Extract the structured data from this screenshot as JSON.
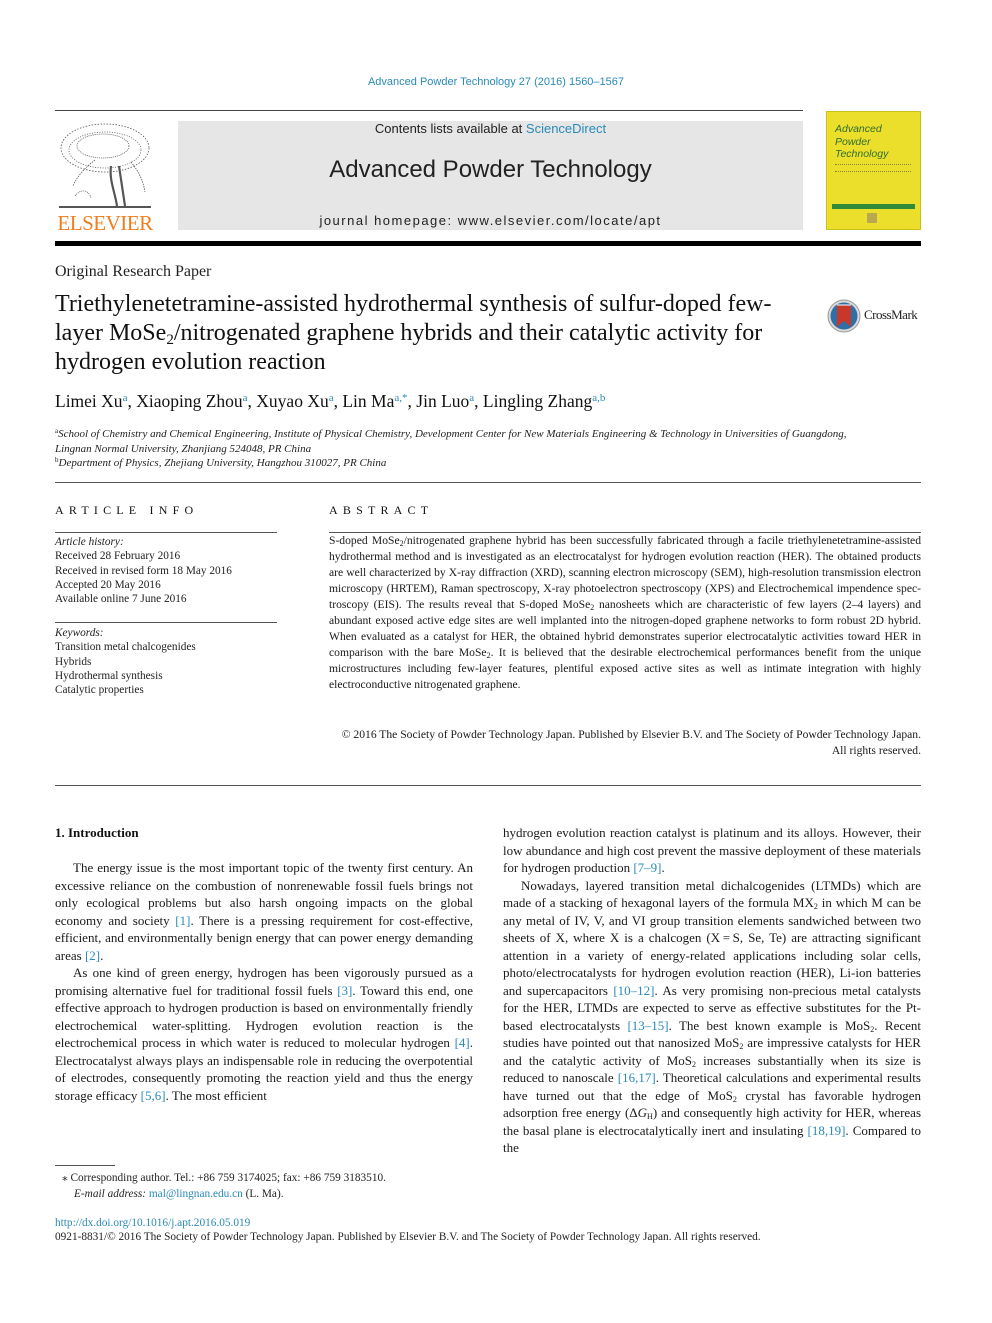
{
  "running_head": "Advanced Powder Technology 27 (2016) 1560–1567",
  "masthead": {
    "publisher_logo_text": "ELSEVIER",
    "contents_prefix": "Contents lists available at ",
    "contents_link": "ScienceDirect",
    "journal_title": "Advanced Powder Technology",
    "homepage_prefix": "journal homepage: ",
    "homepage_url": "www.elsevier.com/locate/apt",
    "cover_title_lines": [
      "Advanced",
      "Powder",
      "Technology"
    ]
  },
  "article": {
    "type": "Original Research Paper",
    "title_part1": "Triethylenetetramine-assisted hydrothermal synthesis of sulfur-doped few-layer MoSe",
    "title_sub": "2",
    "title_part2": "/nitrogenated graphene hybrids and their catalytic activity for hydrogen evolution reaction",
    "crossmark_label": "CrossMark",
    "authors": [
      {
        "name": "Limei Xu",
        "aff": "a"
      },
      {
        "name": "Xiaoping Zhou",
        "aff": "a"
      },
      {
        "name": "Xuyao Xu",
        "aff": "a"
      },
      {
        "name": "Lin Ma",
        "aff": "a,*"
      },
      {
        "name": "Jin Luo",
        "aff": "a"
      },
      {
        "name": "Lingling Zhang",
        "aff": "a,b"
      }
    ],
    "affiliations": [
      {
        "mark": "a",
        "text": "School of Chemistry and Chemical Engineering, Institute of Physical Chemistry, Development Center for New Materials Engineering & Technology in Universities of Guangdong, Lingnan Normal University, Zhanjiang 524048, PR China"
      },
      {
        "mark": "b",
        "text": "Department of Physics, Zhejiang University, Hangzhou 310027, PR China"
      }
    ]
  },
  "article_info": {
    "heading": "ARTICLE INFO",
    "history_label": "Article history:",
    "history": [
      "Received 28 February 2016",
      "Received in revised form 18 May 2016",
      "Accepted 20 May 2016",
      "Available online 7 June 2016"
    ],
    "keywords_label": "Keywords:",
    "keywords": [
      "Transition metal chalcogenides",
      "Hybrids",
      "Hydrothermal synthesis",
      "Catalytic properties"
    ]
  },
  "abstract": {
    "heading": "ABSTRACT",
    "seg1": "S-doped MoSe",
    "seg2": "/nitrogenated graphene hybrid has been successfully fabricated through a facile triethylenetetramine-assisted hydrothermal method and is investigated as an electrocatalyst for hydro­gen evolution reaction (HER). The obtained products are well characterized by X-ray diffraction (XRD), scanning electron microscopy (SEM), high-resolution transmission electron microscopy (HRTEM), Raman spectroscopy, X-ray photoelectron spectroscopy (XPS) and Electrochemical impendence spec­troscopy (EIS). The results reveal that S-doped MoSe",
    "seg3": " nanosheets which are characteristic of few layers (2–4 layers) and abundant exposed active edge sites are well implanted into the nitrogen-doped gra­phene networks to form robust 2D hybrid. When evaluated as a catalyst for HER, the obtained hybrid demonstrates superior electrocatalytic activities toward HER in comparison with the bare MoSe",
    "seg4": ". It is believed that the desirable electrochemical performances benefit from the unique microstructures including few-layer features, plentiful exposed active sites as well as intimate integration with highly electroconductive nitrogenated graphene.",
    "sub": "2",
    "copyright": "© 2016 The Society of Powder Technology Japan. Published by Elsevier B.V. and The Society of Powder Technology Japan. All rights reserved."
  },
  "introduction": {
    "heading": "1. Introduction",
    "p1_a": "The energy issue is the most important topic of the twenty first century. An excessive reliance on the combustion of nonrenewable fossil fuels brings not only ecological problems but also harsh ongoing impacts on the global economy and society ",
    "p1_ref1": "[1]",
    "p1_b": ". There is a pressing requirement for cost-effective, efficient, and environ­mentally benign energy that can power energy demanding areas ",
    "p1_ref2": "[2]",
    "p1_c": ".",
    "p2_a": "As one kind of green energy, hydrogen has been vigorously pur­sued as a promising alternative fuel for traditional fossil fuels ",
    "p2_ref1": "[3]",
    "p2_b": ". Toward this end, one effective approach to hydrogen production is based on environmentally friendly electrochemical water-splitting. Hydrogen evolution reaction is the electrochemical process in which water is reduced to molecular hydrogen ",
    "p2_ref2": "[4]",
    "p2_c": ". Electrocatalyst always plays an indispensable role in reducing the overpotential of electrodes, consequently promoting the reaction yield and thus the energy storage efficacy ",
    "p2_ref3": "[5,6]",
    "p2_d": ". The most efficient hydrogen evolution reaction catalyst is platinum and its alloys. However, their low abundance and high cost prevent the massive deployment of these materials for hydrogen production ",
    "p2_ref4": "[7–9]",
    "p2_e": ".",
    "p3_a": "Nowadays, layered transition metal dichalcogenides (LTMDs) which are made of a stacking of hexagonal layers of the formula MX",
    "p3_b": " in which M can be any metal of IV, V, and VI group transition elements sandwiched between two sheets of X, where X is a chalcogen (X = S, Se, Te) are attracting significant attention in a variety of energy-related applications including solar cells, photo/electrocatalysts for hydrogen evolution reaction (HER), Li-ion batteries and supercapacitors ",
    "p3_ref1": "[10–12]",
    "p3_c": ". As very promising non-precious metal catalysts for the HER, LTMDs are expected to serve as effective substitutes for the Pt-based electrocatalysts ",
    "p3_ref2": "[13–15]",
    "p3_d": ". The best known example is MoS",
    "p3_e": ". Recent studies have pointed out that nanosized MoS",
    "p3_f": " are impressive catalysts for HER and the catalytic activity of MoS",
    "p3_g": " increases substantially when its size is reduced to nanoscale ",
    "p3_ref3": "[16,17]",
    "p3_h": ". Theoretical calculations and experimental results have turned out that the edge of MoS",
    "p3_i": " crystal has favorable hydrogen adsorption free energy (Δ",
    "p3_G": "G",
    "p3_H": "H",
    "p3_j": ") and consequently high activity for HER, whereas the basal plane is electrocatalytically inert and insulating ",
    "p3_ref4": "[18,19]",
    "p3_k": ". Compared to the",
    "sub2": "2"
  },
  "footnotes": {
    "corresponding": "⁎ Corresponding author. Tel.: +86 759 3174025; fax: +86 759 3183510.",
    "email_label": "E-mail address:",
    "email": "mal@lingnan.edu.cn",
    "email_suffix": " (L. Ma)."
  },
  "doi": "http://dx.doi.org/10.1016/j.apt.2016.05.019",
  "issn_line": "0921-8831/© 2016 The Society of Powder Technology Japan. Published by Elsevier B.V. and The Society of Powder Technology Japan. All rights reserved."
}
